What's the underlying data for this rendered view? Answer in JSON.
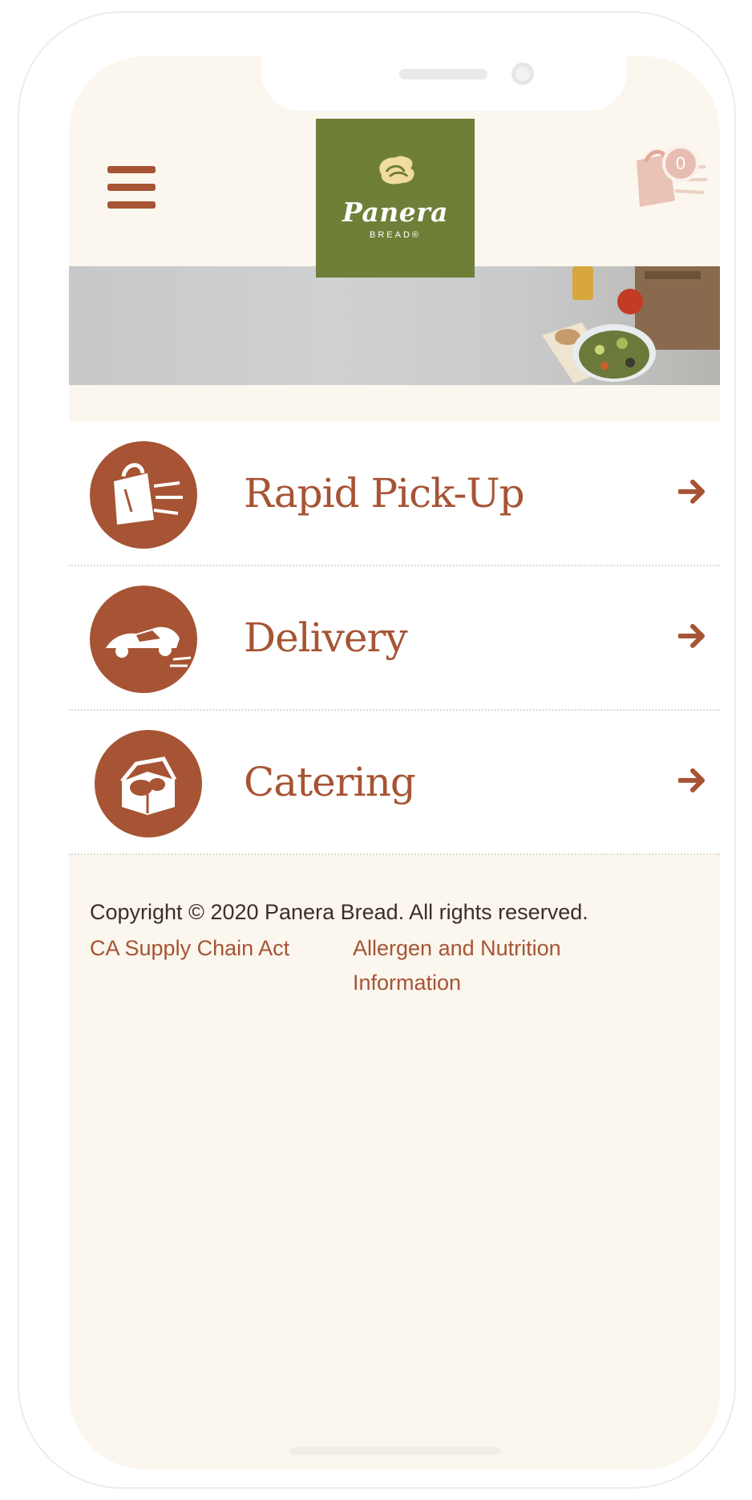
{
  "header": {
    "menu_icon": "hamburger-menu-icon",
    "logo": {
      "word": "Panera",
      "sub": "BREAD®",
      "color": "#6f7f38"
    },
    "cart": {
      "icon": "bag-icon",
      "count": "0"
    }
  },
  "hero": {
    "description_icon": "food-banner"
  },
  "options": [
    {
      "label": "Rapid Pick-Up",
      "icon": "fast-bag-icon"
    },
    {
      "label": "Delivery",
      "icon": "delivery-car-icon"
    },
    {
      "label": "Catering",
      "icon": "catering-box-icon"
    }
  ],
  "footer": {
    "copyright": "Copyright © 2020 Panera Bread. All rights reserved.",
    "links": {
      "supply_chain": "CA Supply Chain Act",
      "allergen_line1": "Allergen and Nutrition",
      "allergen_line2": "Information"
    }
  },
  "colors": {
    "accent": "#a65434",
    "background": "#fbf6ee"
  }
}
